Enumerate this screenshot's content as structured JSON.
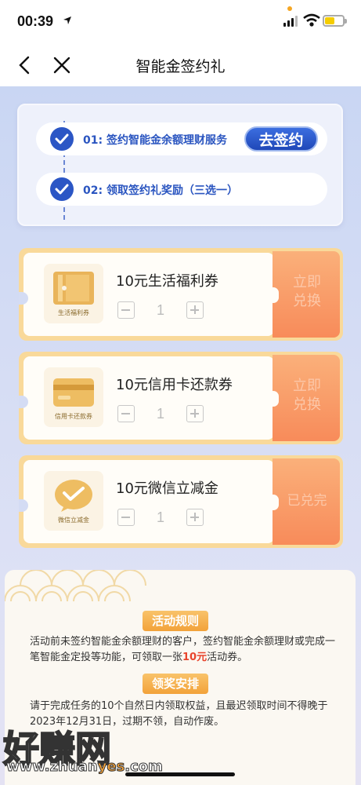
{
  "status_bar": {
    "time": "00:39"
  },
  "nav": {
    "title": "智能金签约礼"
  },
  "steps": [
    {
      "text": "01: 签约智能金余额理财服务",
      "action": "去签约"
    },
    {
      "text": "02: 领取签约礼奖励（三选一）"
    }
  ],
  "rewards": [
    {
      "title": "10元生活福利券",
      "thumb_label": "生活福利券",
      "quantity": "1",
      "button": "立即兑换",
      "button_line1": "立即",
      "button_line2": "兑换"
    },
    {
      "title": "10元信用卡还款券",
      "thumb_label": "信用卡还款券",
      "quantity": "1",
      "button": "立即兑换",
      "button_line1": "立即",
      "button_line2": "兑换"
    },
    {
      "title": "10元微信立减金",
      "thumb_label": "微信立减金",
      "quantity": "1",
      "button": "已兑完"
    }
  ],
  "rules": {
    "heading1": "活动规则",
    "text1_a": "活动前未签约智能金余额理财的客户，签约智能金余额理财或完成一笔智能金定投等功能，可领取一张",
    "text1_hl": "10元",
    "text1_b": "活动券。",
    "heading2": "领奖安排",
    "text2": "请于完成任务的10个自然日内领取权益，且最迟领取时间不得晚于2023年12月31日，过期不领，自动作废。"
  },
  "watermark": {
    "zh": "好赚网",
    "en_a": "www.zhuan",
    "en_b": "yes",
    "en_c": ".com"
  },
  "colors": {
    "primary_blue": "#2b56c5",
    "redeem_orange": "#f88b5a",
    "card_gold": "#f9d99a",
    "badge_orange": "#f2a23a"
  },
  "icons": [
    "location-arrow-icon",
    "signal-icon",
    "wifi-icon",
    "battery-icon",
    "back-icon",
    "close-icon",
    "check-icon",
    "ticket-icon",
    "credit-card-icon",
    "wechat-pay-icon"
  ]
}
